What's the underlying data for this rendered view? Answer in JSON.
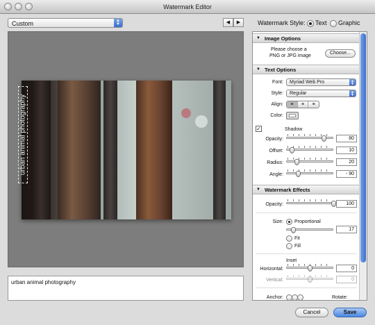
{
  "window": {
    "title": "Watermark Editor"
  },
  "preset": {
    "selected": "Custom"
  },
  "nav": {
    "prev": "◀",
    "next": "▶"
  },
  "style": {
    "label": "Watermark Style:",
    "options": [
      "Text",
      "Graphic"
    ],
    "selected": "Text"
  },
  "preview": {
    "watermark_text": "urban animal photography"
  },
  "text_input": {
    "value": "urban animal photography"
  },
  "image_options": {
    "header": "Image Options",
    "hint_line1": "Please choose a",
    "hint_line2": "PNG or JPG image",
    "choose_label": "Choose..."
  },
  "text_options": {
    "header": "Text Options",
    "font_label": "Font:",
    "font_value": "Myriad Web Pro",
    "style_label": "Style:",
    "style_value": "Regular",
    "align_label": "Align:",
    "color_label": "Color:"
  },
  "shadow": {
    "label": "Shadow",
    "checked": true,
    "opacity": {
      "label": "Opacity:",
      "value": "80"
    },
    "offset": {
      "label": "Offset:",
      "value": "10"
    },
    "radius": {
      "label": "Radius:",
      "value": "20"
    },
    "angle": {
      "label": "Angle:",
      "value": "- 90"
    }
  },
  "effects": {
    "header": "Watermark Effects",
    "opacity": {
      "label": "Opacity:",
      "value": "100"
    },
    "size_label": "Size:",
    "size_options": [
      "Proportional",
      "Fit",
      "Fill"
    ],
    "size_selected": "Proportional",
    "size_value": "17",
    "inset_label": "Inset",
    "horizontal": {
      "label": "Horizontal:",
      "value": "0"
    },
    "vertical": {
      "label": "Vertical:",
      "value": "0"
    },
    "anchor_label": "Anchor:",
    "rotate_label": "Rotate:"
  },
  "buttons": {
    "cancel": "Cancel",
    "save": "Save"
  },
  "icons": [
    "close-light",
    "minimize-light",
    "zoom-light",
    "triangle-down-icon",
    "checkbox-icon",
    "align-left-icon",
    "align-center-icon",
    "align-right-icon",
    "color-well-icon"
  ],
  "colors": {
    "accent": "#3a6fd0",
    "panel_bg": "#ffffff",
    "window_bg": "#dcdcdc"
  }
}
